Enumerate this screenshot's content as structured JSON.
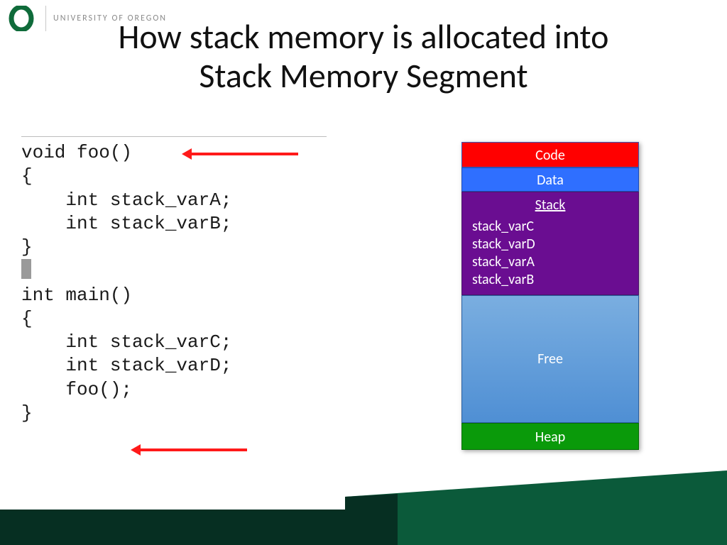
{
  "header": {
    "university": "UNIVERSITY OF OREGON"
  },
  "title": {
    "line1": "How stack memory is allocated into",
    "line2": "Stack Memory Segment"
  },
  "code": {
    "l1": "void foo()",
    "l2": "{",
    "l3": "    int stack_varA;",
    "l4": "    int stack_varB;",
    "l5": "}",
    "l6": "int main()",
    "l7": "{",
    "l8": "    int stack_varC;",
    "l9": "    int stack_varD;",
    "l10": "    foo();",
    "l11": "}"
  },
  "memory": {
    "code": "Code",
    "data": "Data",
    "stack_label": "Stack",
    "stack_vars": {
      "v1": "stack_varC",
      "v2": "stack_varD",
      "v3": "stack_varA",
      "v4": "stack_varB"
    },
    "free": "Free",
    "heap": "Heap"
  },
  "colors": {
    "brand_green": "#0b5a3a",
    "code_red": "#ff0000",
    "data_blue": "#2f6fff",
    "stack_purple": "#6a0d91",
    "heap_green": "#0a9a0a"
  }
}
